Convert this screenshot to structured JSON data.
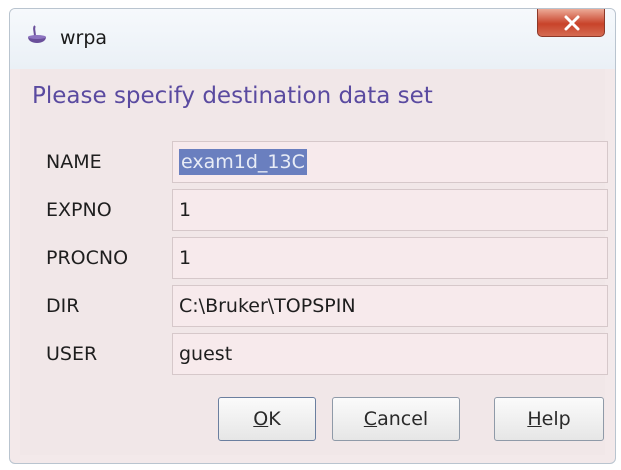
{
  "window": {
    "title": "wrpa"
  },
  "dialog": {
    "prompt": "Please specify destination data set",
    "fields": [
      {
        "label": "NAME",
        "value": "exam1d_13C",
        "selected": true
      },
      {
        "label": "EXPNO",
        "value": "1",
        "selected": false
      },
      {
        "label": "PROCNO",
        "value": "1",
        "selected": false
      },
      {
        "label": "DIR",
        "value": "C:\\Bruker\\TOPSPIN",
        "selected": false
      },
      {
        "label": "USER",
        "value": "guest",
        "selected": false
      }
    ]
  },
  "buttons": {
    "ok": {
      "mnemonic": "O",
      "rest": "K"
    },
    "cancel": {
      "mnemonic": "C",
      "rest": "ancel"
    },
    "help": {
      "mnemonic": "H",
      "rest": "elp"
    }
  },
  "icons": {
    "app": "topspin-app-icon",
    "close": "close-icon"
  },
  "colors": {
    "prompt_text": "#5a4aa0",
    "selection": "#6a7fbf",
    "close_button": "#c8432a",
    "field_background": "#f7eaec"
  }
}
